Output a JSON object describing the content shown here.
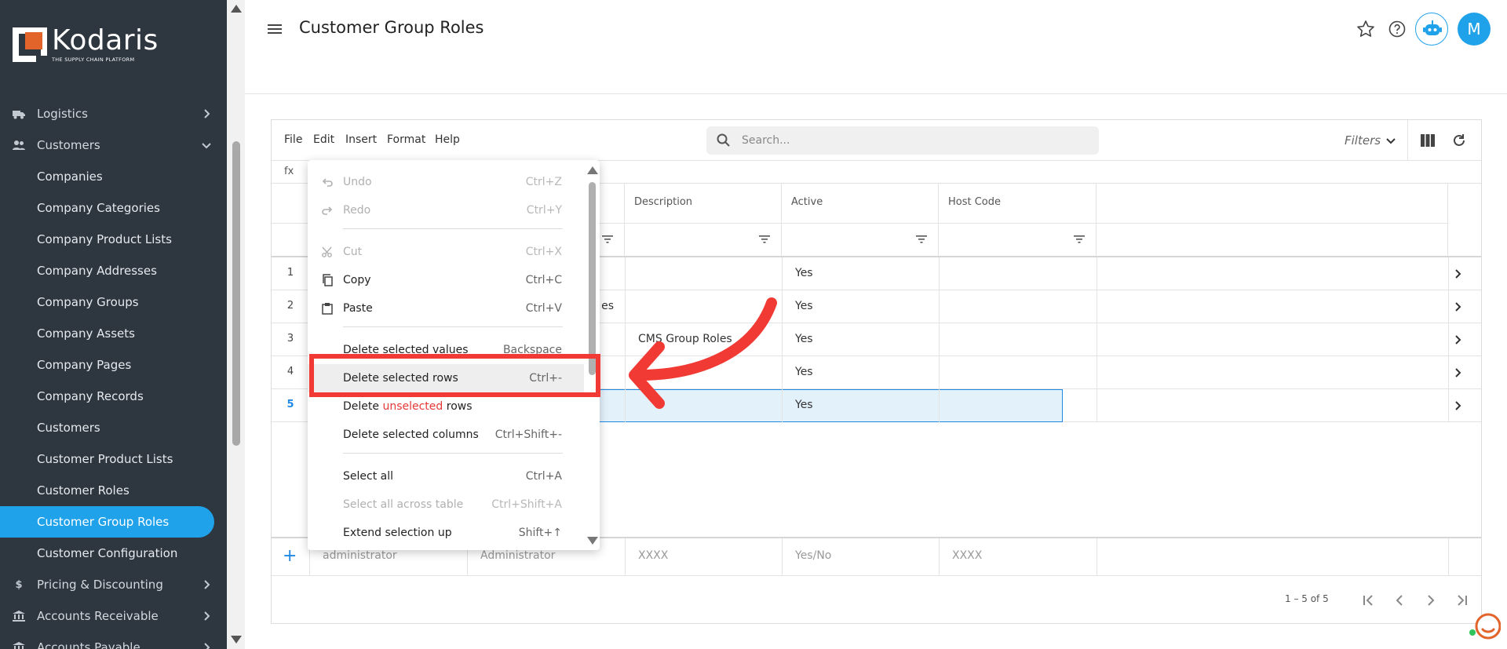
{
  "app": {
    "logo_name": "Kodaris",
    "logo_tagline": "THE SUPPLY CHAIN PLATFORM",
    "brand_color": "#1fa2e9"
  },
  "sidebar": {
    "sections": [
      {
        "label": "Logistics",
        "icon": "truck-icon"
      },
      {
        "label": "Customers",
        "icon": "users-icon",
        "expanded": true
      }
    ],
    "customers_items": [
      "Companies",
      "Company Categories",
      "Company Product Lists",
      "Company Addresses",
      "Company Groups",
      "Company Assets",
      "Company Pages",
      "Company Records",
      "Customers",
      "Customer Product Lists",
      "Customer Roles",
      "Customer Group Roles",
      "Customer Configuration"
    ],
    "active_item": "Customer Group Roles",
    "after_sections": [
      {
        "label": "Pricing & Discounting",
        "icon": "dollar-icon"
      },
      {
        "label": "Accounts Receivable",
        "icon": "bank-icon"
      },
      {
        "label": "Accounts Payable",
        "icon": "bank-icon"
      }
    ]
  },
  "header": {
    "title": "Customer Group Roles",
    "avatar_initial": "M"
  },
  "toolbar": {
    "menus": [
      "File",
      "Edit",
      "Insert",
      "Format",
      "Help"
    ],
    "search_placeholder": "Search...",
    "filters_label": "Filters"
  },
  "formula_bar": {
    "label": "fx"
  },
  "grid": {
    "columns": [
      "",
      "",
      "Description",
      "Active",
      "Host Code"
    ],
    "rows": [
      {
        "num": "1",
        "c2": "",
        "desc": "",
        "active": "Yes",
        "host": ""
      },
      {
        "num": "2",
        "c2": "es",
        "desc": "",
        "active": "Yes",
        "host": ""
      },
      {
        "num": "3",
        "c2": "",
        "desc": "CMS Group Roles",
        "active": "Yes",
        "host": ""
      },
      {
        "num": "4",
        "c2": "",
        "desc": "",
        "active": "Yes",
        "host": ""
      },
      {
        "num": "5",
        "c2": "",
        "desc": "",
        "active": "Yes",
        "host": ""
      }
    ],
    "new_row_placeholders": [
      "administrator",
      "Administrator",
      "XXXX",
      "Yes/No",
      "XXXX"
    ],
    "page_info": "1 – 5 of 5"
  },
  "context_menu": {
    "items": [
      {
        "label": "Undo",
        "shortcut": "Ctrl+Z",
        "disabled": true,
        "icon": "undo-icon"
      },
      {
        "label": "Redo",
        "shortcut": "Ctrl+Y",
        "disabled": true,
        "icon": "redo-icon"
      },
      {
        "label": "Cut",
        "shortcut": "Ctrl+X",
        "disabled": true,
        "icon": "cut-icon"
      },
      {
        "label": "Copy",
        "shortcut": "Ctrl+C",
        "disabled": false,
        "icon": "copy-icon"
      },
      {
        "label": "Paste",
        "shortcut": "Ctrl+V",
        "disabled": false,
        "icon": "paste-icon"
      },
      {
        "label": "Delete selected values",
        "shortcut": "Backspace",
        "disabled": false
      },
      {
        "label": "Delete selected rows",
        "shortcut": "Ctrl+-",
        "disabled": false,
        "highlighted": true
      },
      {
        "label_pre": "Delete ",
        "label_red": "unselected",
        "label_post": " rows",
        "shortcut": "",
        "disabled": false
      },
      {
        "label": "Delete selected columns",
        "shortcut": "Ctrl+Shift+-",
        "disabled": false
      },
      {
        "label": "Select all",
        "shortcut": "Ctrl+A",
        "disabled": false
      },
      {
        "label": "Select all across table",
        "shortcut": "Ctrl+Shift+A",
        "disabled": true
      },
      {
        "label": "Extend selection up",
        "shortcut": "Shift+↑",
        "disabled": false
      }
    ]
  },
  "annotation": {
    "color": "#f03a33"
  }
}
